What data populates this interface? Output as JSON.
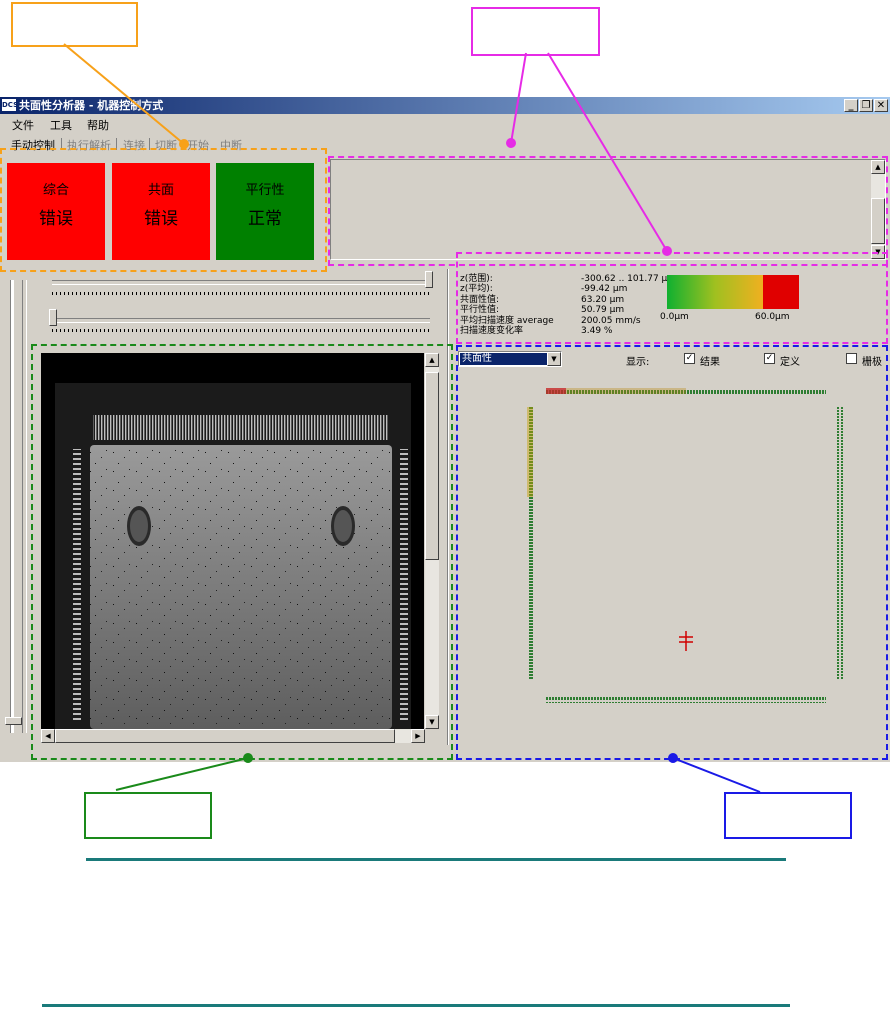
{
  "window": {
    "app_icon": "DCS",
    "title": "共面性分析器 - 机器控制方式",
    "buttons": [
      "_",
      "❐",
      "✕"
    ]
  },
  "menu": [
    "文件",
    "工具",
    "帮助"
  ],
  "toolbar": [
    {
      "label": "手动控制",
      "active": true
    },
    {
      "label": "执行解析",
      "active": false
    },
    {
      "label": "连接",
      "active": false
    },
    {
      "label": "切断",
      "active": false
    },
    {
      "label": "开始",
      "active": false
    },
    {
      "label": "中断",
      "active": false
    }
  ],
  "status": [
    {
      "label": "综合",
      "value": "错误",
      "color": "#ff0000"
    },
    {
      "label": "共面",
      "value": "错误",
      "color": "#ff0000"
    },
    {
      "label": "平行性",
      "value": "正常",
      "color": "#008000"
    }
  ],
  "stats": {
    "labels": [
      "z(范围):",
      "z(平均):",
      "共面性值:",
      "平行性值:",
      "平均扫描速度 average",
      "扫描速度变化率"
    ],
    "values": [
      "-300.62 .. 101.77 µm",
      "-99.42 µm",
      "63.20 µm",
      "50.79 µm",
      "200.05 mm/s",
      "3.49 %"
    ]
  },
  "legend": {
    "min_label": "0.0µm",
    "max_label": "60.0µm"
  },
  "view": {
    "mode_selected": "共面性",
    "display_label": "显示:",
    "checkboxes": [
      {
        "label": "结果",
        "checked": true
      },
      {
        "label": "定义",
        "checked": true
      },
      {
        "label": "栅极",
        "checked": false
      }
    ]
  },
  "colors": {
    "orange": "#f7a11a",
    "magenta": "#e62be6",
    "green": "#1a8a1a",
    "blue": "#1a1ae6",
    "teal": "#1a7a7a"
  }
}
